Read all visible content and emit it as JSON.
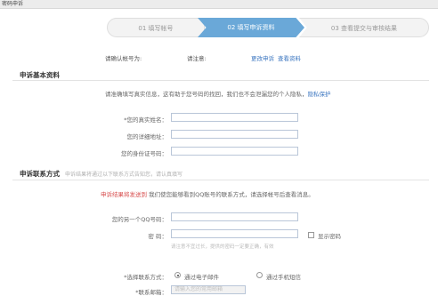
{
  "window": {
    "title": "密码申诉"
  },
  "steps": [
    {
      "label": "01 填写帐号"
    },
    {
      "label": "02 填写申诉资料"
    },
    {
      "label": "03 查看提交与审核结果"
    }
  ],
  "account": {
    "label": "请确认帐号为:",
    "value": "请注意:",
    "link1": "更改申诉",
    "link2": "查看资料"
  },
  "section_basic": {
    "title": "申诉基本资料",
    "intro": "请准确填写真实信息，这有助于您号码的找回，我们也不会泄漏您的个人隐私，",
    "intro_link": "隐私保护",
    "fields": [
      {
        "label": "*您的真实姓名："
      },
      {
        "label": "您的详细地址："
      },
      {
        "label": "您的身份证号码："
      }
    ]
  },
  "section_contact": {
    "title": "申诉联系方式",
    "subtitle": "申诉结果将通过以下联系方式告知您，请认真填写",
    "warning": "申诉结果将发送到",
    "notice": "我们使您能够看到QQ账号的联系方式，请选择帐号后查看消息。",
    "qq_label": "您的另一个QQ号码：",
    "pwd_label": "密 码：",
    "pwd_hint": "请注意不宜过长，提供的密码一定要正确，有效",
    "show_pwd": "显示密码",
    "method_label": "*选择联系方式：",
    "method_options": [
      "通过电子邮件",
      "通过手机短信"
    ],
    "email_label": "*联系邮箱：",
    "email_placeholder": "请输入您的常用邮箱"
  }
}
